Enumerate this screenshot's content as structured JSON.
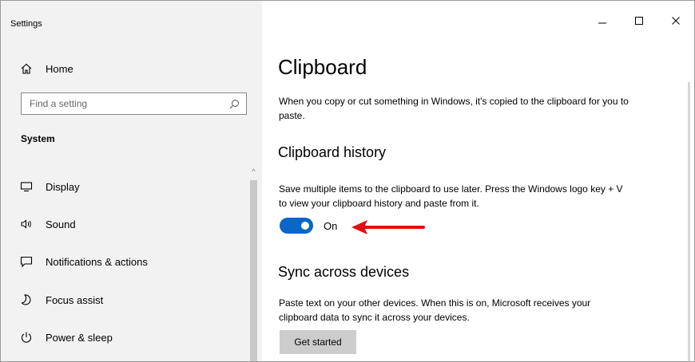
{
  "window": {
    "title": "Settings"
  },
  "sidebar": {
    "home_label": "Home",
    "search_placeholder": "Find a setting",
    "section_heading": "System",
    "items": [
      {
        "label": "Display",
        "icon": "display-icon"
      },
      {
        "label": "Sound",
        "icon": "speaker-icon"
      },
      {
        "label": "Notifications & actions",
        "icon": "notification-icon"
      },
      {
        "label": "Focus assist",
        "icon": "moon-icon"
      },
      {
        "label": "Power & sleep",
        "icon": "power-icon"
      }
    ]
  },
  "main": {
    "title": "Clipboard",
    "intro": "When you copy or cut something in Windows, it's copied to the clipboard for you to paste.",
    "history": {
      "heading": "Clipboard history",
      "description": "Save multiple items to the clipboard to use later. Press the Windows logo key + V to view your clipboard history and paste from it.",
      "toggle_state": "On",
      "toggle_on": true
    },
    "sync": {
      "heading": "Sync across devices",
      "description": "Paste text on your other devices. When this is on, Microsoft receives your clipboard data to sync it across your devices.",
      "button_label": "Get started"
    }
  },
  "colors": {
    "accent": "#0a66c8",
    "annotation_arrow": "#e01010",
    "sidebar_bg": "#f2f2f2"
  }
}
